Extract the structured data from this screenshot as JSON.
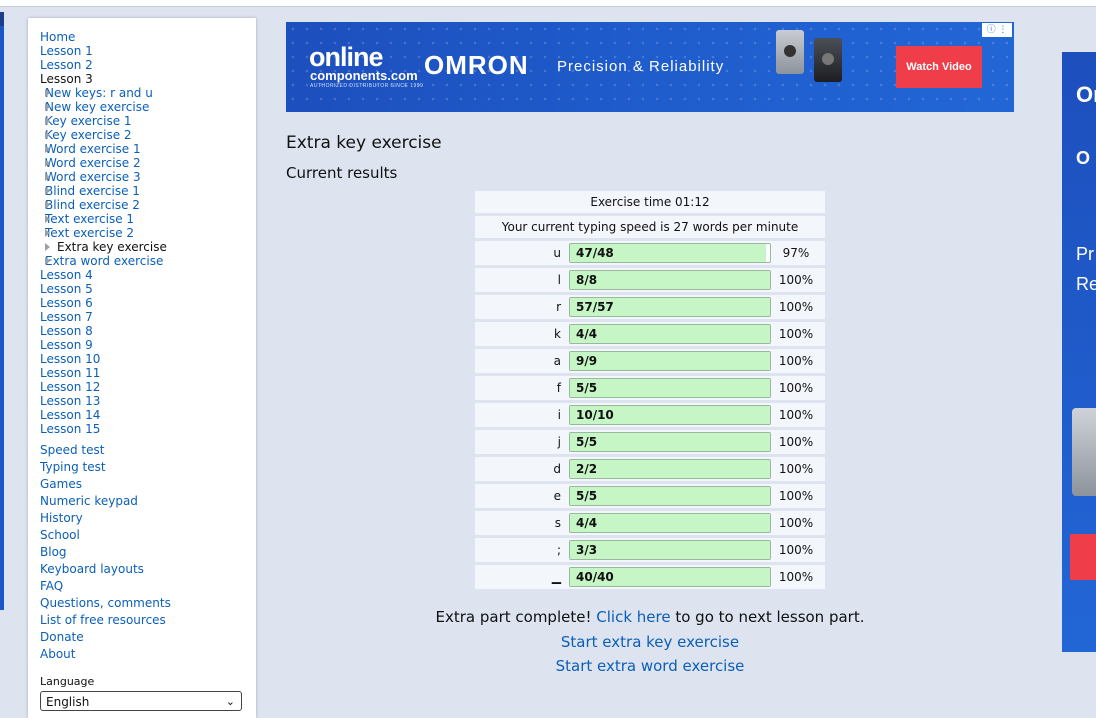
{
  "sidebar": {
    "top_items": [
      {
        "label": "Home",
        "current": false
      },
      {
        "label": "Lesson 1",
        "current": false
      },
      {
        "label": "Lesson 2",
        "current": false
      },
      {
        "label": "Lesson 3",
        "current": true
      }
    ],
    "lesson3_items": [
      {
        "label": "New keys: r and u",
        "current": false
      },
      {
        "label": "New key exercise",
        "current": false
      },
      {
        "label": "Key exercise 1",
        "current": false
      },
      {
        "label": "Key exercise 2",
        "current": false
      },
      {
        "label": "Word exercise 1",
        "current": false
      },
      {
        "label": "Word exercise 2",
        "current": false
      },
      {
        "label": "Word exercise 3",
        "current": false
      },
      {
        "label": "Blind exercise 1",
        "current": false
      },
      {
        "label": "Blind exercise 2",
        "current": false
      },
      {
        "label": "Text exercise 1",
        "current": false
      },
      {
        "label": "Text exercise 2",
        "current": false
      },
      {
        "label": "Extra key exercise",
        "current": true
      },
      {
        "label": "Extra word exercise",
        "current": false
      }
    ],
    "later_lessons": [
      "Lesson 4",
      "Lesson 5",
      "Lesson 6",
      "Lesson 7",
      "Lesson 8",
      "Lesson 9",
      "Lesson 10",
      "Lesson 11",
      "Lesson 12",
      "Lesson 13",
      "Lesson 14",
      "Lesson 15"
    ],
    "bottom_items": [
      "Speed test",
      "Typing test",
      "Games",
      "Numeric keypad",
      "History",
      "School",
      "Blog",
      "Keyboard layouts",
      "FAQ",
      "Questions, comments",
      "List of free resources",
      "Donate",
      "About"
    ],
    "language_label": "Language",
    "language_value": "English"
  },
  "banner": {
    "logo_line1": "online",
    "logo_line2": "components.com",
    "logo_tag": "AUTHORIZED DISTRIBUTOR SINCE 1999",
    "brand": "OMRON",
    "tagline": "Precision & Reliability",
    "button": "Watch Video",
    "adchoices_icon": "info-icon"
  },
  "right_ad": {
    "text1": "Or",
    "text2": "O",
    "text3": "Pr",
    "text4": "Re"
  },
  "main": {
    "title": "Extra key exercise",
    "subtitle": "Current results",
    "exercise_time": "Exercise time 01:12",
    "speed": "Your current typing speed is 27 words per minute",
    "rows": [
      {
        "key": "u",
        "count": "47/48",
        "pct": "97%",
        "fraction": 0.979
      },
      {
        "key": "l",
        "count": "8/8",
        "pct": "100%",
        "fraction": 1
      },
      {
        "key": "r",
        "count": "57/57",
        "pct": "100%",
        "fraction": 1
      },
      {
        "key": "k",
        "count": "4/4",
        "pct": "100%",
        "fraction": 1
      },
      {
        "key": "a",
        "count": "9/9",
        "pct": "100%",
        "fraction": 1
      },
      {
        "key": "f",
        "count": "5/5",
        "pct": "100%",
        "fraction": 1
      },
      {
        "key": "i",
        "count": "10/10",
        "pct": "100%",
        "fraction": 1
      },
      {
        "key": "j",
        "count": "5/5",
        "pct": "100%",
        "fraction": 1
      },
      {
        "key": "d",
        "count": "2/2",
        "pct": "100%",
        "fraction": 1
      },
      {
        "key": "e",
        "count": "5/5",
        "pct": "100%",
        "fraction": 1
      },
      {
        "key": "s",
        "count": "4/4",
        "pct": "100%",
        "fraction": 1
      },
      {
        "key": ";",
        "count": "3/3",
        "pct": "100%",
        "fraction": 1
      },
      {
        "key": "▁",
        "count": "40/40",
        "pct": "100%",
        "fraction": 1
      }
    ],
    "complete_prefix": "Extra part complete!",
    "complete_link": "Click here",
    "complete_suffix": "to go to next lesson part.",
    "action1": "Start extra key exercise",
    "action2": "Start extra word exercise"
  },
  "colors": {
    "page_bg": "#dde3ef",
    "link": "#0b5fb8",
    "bar_fill": "#c6f6c6",
    "ad_blue": "#1f5ccc",
    "ad_button": "#ef3d4a"
  }
}
